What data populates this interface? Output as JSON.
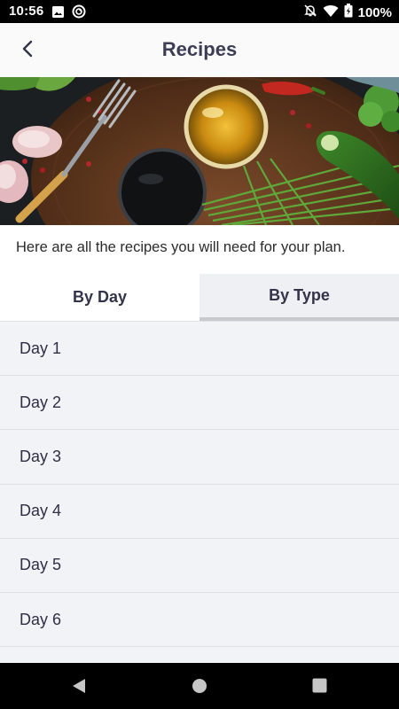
{
  "status_bar": {
    "time": "10:56",
    "battery": "100%",
    "left_icons": [
      "image-icon",
      "sync-icon"
    ],
    "right_icons": [
      "bell-off-icon",
      "wifi-icon",
      "battery-icon"
    ]
  },
  "header": {
    "title": "Recipes",
    "back_icon": "chevron-left-icon"
  },
  "hero": {
    "image": "food-ingredients-photo"
  },
  "intro": {
    "text": "Here are all the recipes you will need for your plan."
  },
  "tabs": [
    {
      "label": "By Day",
      "selected": true
    },
    {
      "label": "By Type",
      "selected": false
    }
  ],
  "days": [
    {
      "label": "Day 1"
    },
    {
      "label": "Day 2"
    },
    {
      "label": "Day 3"
    },
    {
      "label": "Day 4"
    },
    {
      "label": "Day 5"
    },
    {
      "label": "Day 6"
    }
  ],
  "nav_bar": {
    "buttons": [
      "back-triangle-icon",
      "home-circle-icon",
      "recents-square-icon"
    ]
  },
  "colors": {
    "title": "#3d3d55",
    "list_bg": "#f1f3f6",
    "tab_inactive_bg": "#eef0f3",
    "tab_indicator": "#c7c9cf"
  }
}
